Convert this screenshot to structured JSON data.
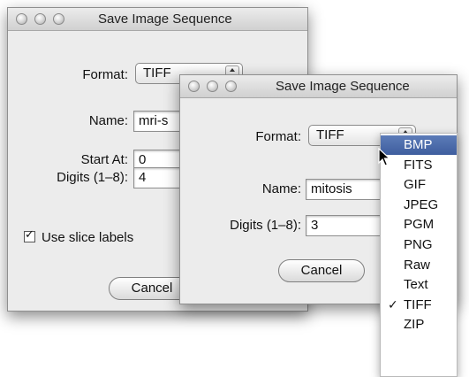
{
  "back_dialog": {
    "title": "Save Image Sequence",
    "format_label": "Format:",
    "format_value": "TIFF",
    "name_label": "Name:",
    "name_value": "mri-s",
    "start_label": "Start At:",
    "start_value": "0",
    "digits_label": "Digits (1–8):",
    "digits_value": "4",
    "use_slice_labels": "Use slice labels",
    "cancel_label": "Cancel"
  },
  "front_dialog": {
    "title": "Save Image Sequence",
    "format_label": "Format:",
    "format_value": "TIFF",
    "name_label": "Name:",
    "name_value": "mitosis",
    "digits_label": "Digits (1–8):",
    "digits_value": "3",
    "cancel_label": "Cancel"
  },
  "format_menu": {
    "items": [
      "BMP",
      "FITS",
      "GIF",
      "JPEG",
      "PGM",
      "PNG",
      "Raw",
      "Text",
      "TIFF",
      "ZIP"
    ],
    "highlighted": "BMP",
    "checked": "TIFF",
    "check_glyph": "✓"
  },
  "colors": {
    "highlight": "#3e5e9e",
    "dialog_bg": "#ececec"
  }
}
